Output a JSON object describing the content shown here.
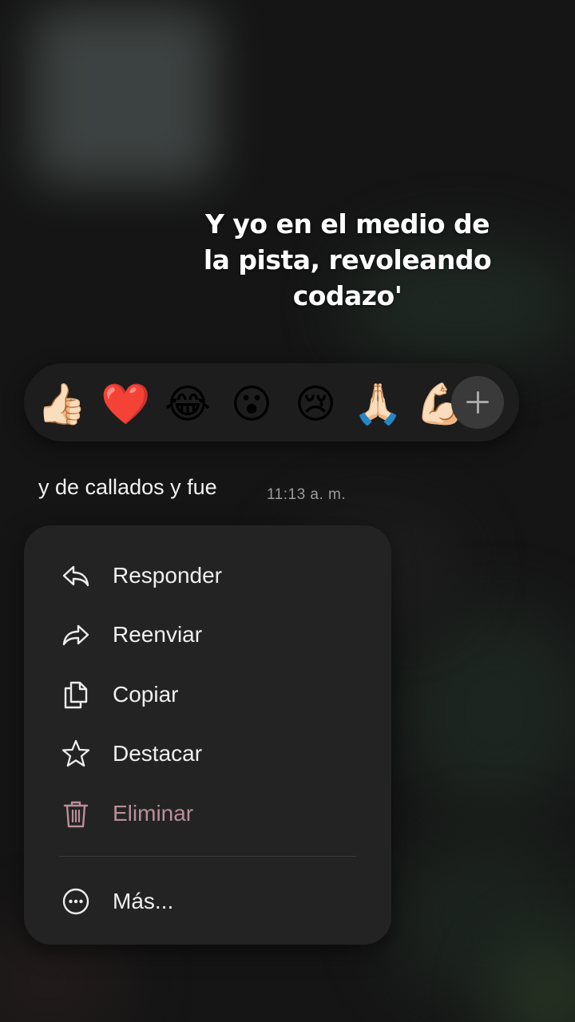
{
  "caption": {
    "line1": "Y yo en el medio de",
    "line2": "la pista, revoleando",
    "line3": "codazo'"
  },
  "reactions": [
    {
      "icon": "thumbs-up-icon",
      "glyph": "👍🏻"
    },
    {
      "icon": "heart-icon",
      "glyph": "❤️"
    },
    {
      "icon": "tears-of-joy-icon",
      "glyph": "😂"
    },
    {
      "icon": "surprised-face-icon",
      "glyph": "😮"
    },
    {
      "icon": "crying-face-icon",
      "glyph": "😢"
    },
    {
      "icon": "folded-hands-icon",
      "glyph": "🙏🏻"
    },
    {
      "icon": "muscle-icon",
      "glyph": "💪🏻"
    }
  ],
  "add_reaction": {
    "icon": "plus-icon"
  },
  "message": {
    "text": "y de callados y fue",
    "time": "11:13 a. m."
  },
  "menu": {
    "items": [
      {
        "label": "Responder",
        "icon": "reply-icon"
      },
      {
        "label": "Reenviar",
        "icon": "forward-icon"
      },
      {
        "label": "Copiar",
        "icon": "copy-icon"
      },
      {
        "label": "Destacar",
        "icon": "star-icon"
      },
      {
        "label": "Eliminar",
        "icon": "trash-icon",
        "color": "#b98f9a"
      }
    ],
    "more": {
      "label": "Más...",
      "icon": "more-icon"
    }
  }
}
